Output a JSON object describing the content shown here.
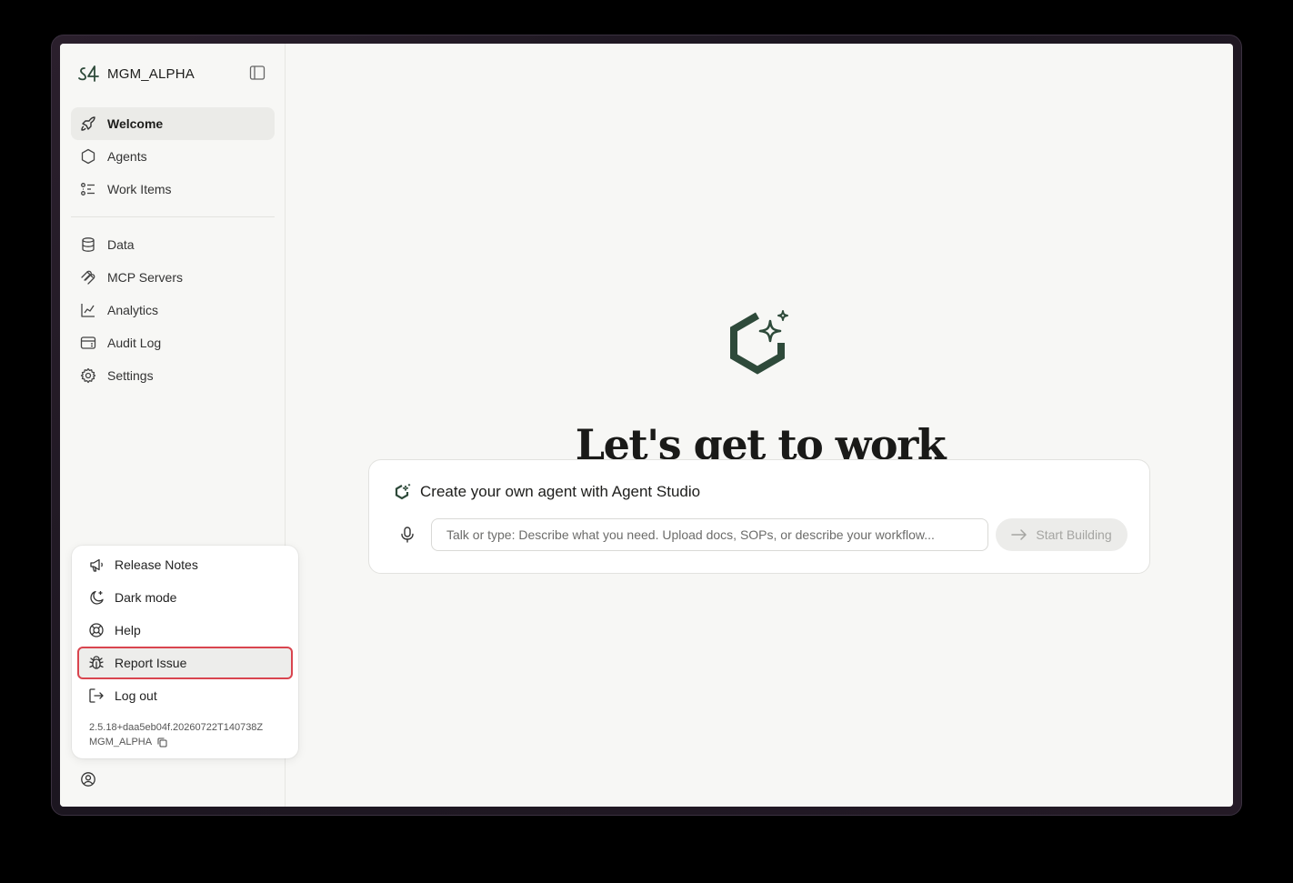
{
  "app": {
    "org_name": "MGM_ALPHA"
  },
  "sidebar": {
    "items": [
      {
        "label": "Welcome",
        "icon": "rocket-icon",
        "active": true
      },
      {
        "label": "Agents",
        "icon": "hexagon-icon"
      },
      {
        "label": "Work Items",
        "icon": "list-icon"
      },
      {
        "label": "Data",
        "icon": "database-icon"
      },
      {
        "label": "MCP Servers",
        "icon": "mcp-icon"
      },
      {
        "label": "Analytics",
        "icon": "chart-line-icon"
      },
      {
        "label": "Audit Log",
        "icon": "audit-log-icon"
      },
      {
        "label": "Settings",
        "icon": "gear-icon"
      }
    ]
  },
  "user_menu": {
    "items": [
      {
        "label": "Release Notes",
        "icon": "megaphone-icon"
      },
      {
        "label": "Dark mode",
        "icon": "moon-star-icon"
      },
      {
        "label": "Help",
        "icon": "lifebuoy-icon"
      },
      {
        "label": "Report Issue",
        "icon": "bug-icon",
        "highlighted": true
      },
      {
        "label": "Log out",
        "icon": "logout-icon"
      }
    ],
    "version": "2.5.18+daa5eb04f.20260722T140738Z",
    "org": "MGM_ALPHA"
  },
  "main": {
    "headline": "Let's get to work",
    "card": {
      "title": "Create your own agent with Agent Studio",
      "input_placeholder": "Talk or type: Describe what you need. Upload docs, SOPs, or describe your workflow...",
      "button_label": "Start Building"
    }
  },
  "colors": {
    "brand_green": "#2e4a3a",
    "highlight_border": "#d9454f",
    "background": "#f7f7f5"
  }
}
